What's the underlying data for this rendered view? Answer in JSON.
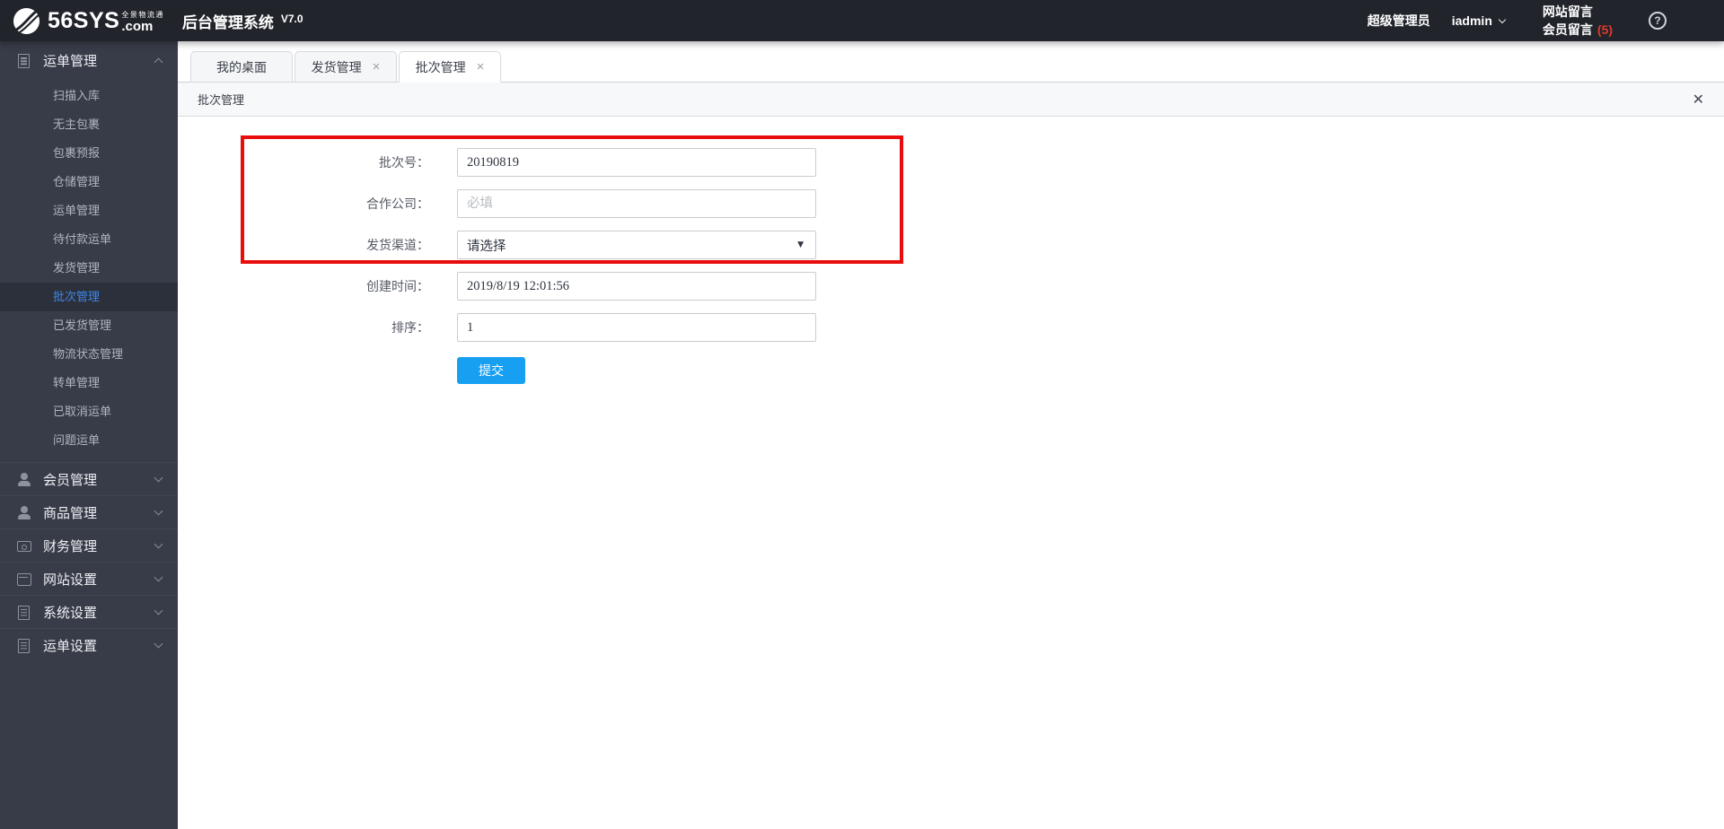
{
  "header": {
    "brand": "56SYS",
    "brand_tld": ".com",
    "brand_tagline": "全景物流通",
    "app_title": "后台管理系统",
    "version": "V7.0",
    "role": "超级管理员",
    "username": "iadmin",
    "nav": [
      {
        "label": "网站留言"
      },
      {
        "label": "会员留言",
        "badge": "(5)"
      }
    ]
  },
  "icons": {
    "close": "×",
    "panel_close": "✕",
    "dropdown": "▼",
    "help": "?"
  },
  "sidebar": {
    "primary": {
      "label": "运单管理",
      "icon": "document-icon"
    },
    "sub_items": [
      {
        "label": "扫描入库"
      },
      {
        "label": "无主包裹"
      },
      {
        "label": "包裹预报"
      },
      {
        "label": "仓储管理"
      },
      {
        "label": "运单管理"
      },
      {
        "label": "待付款运单"
      },
      {
        "label": "发货管理"
      },
      {
        "label": "批次管理",
        "active": true
      },
      {
        "label": "已发货管理"
      },
      {
        "label": "物流状态管理"
      },
      {
        "label": "转单管理"
      },
      {
        "label": "已取消运单"
      },
      {
        "label": "问题运单"
      }
    ],
    "groups": [
      {
        "label": "会员管理",
        "icon": "user-icon"
      },
      {
        "label": "商品管理",
        "icon": "user-icon"
      },
      {
        "label": "财务管理",
        "icon": "finance-icon"
      },
      {
        "label": "网站设置",
        "icon": "window-icon"
      },
      {
        "label": "系统设置",
        "icon": "document-icon"
      },
      {
        "label": "运单设置",
        "icon": "document-icon"
      }
    ]
  },
  "tabs": [
    {
      "label": "我的桌面",
      "closable": false
    },
    {
      "label": "发货管理",
      "closable": true
    },
    {
      "label": "批次管理",
      "closable": true,
      "active": true
    }
  ],
  "panel": {
    "title": "批次管理"
  },
  "form": {
    "fields": [
      {
        "label": "批次号：",
        "is_input": true,
        "value": "20190819"
      },
      {
        "label": "合作公司：",
        "is_input": true,
        "value": "",
        "placeholder": "必填"
      },
      {
        "label": "发货渠道：",
        "is_select": true,
        "value": "请选择"
      },
      {
        "label": "创建时间：",
        "is_input": true,
        "value": "2019/8/19 12:01:56"
      },
      {
        "label": "排序：",
        "is_input": true,
        "value": "1"
      }
    ],
    "submit_label": "提交"
  },
  "colors": {
    "accent": "#17a0f2",
    "annotation": "#e80c0c",
    "badge": "#e03a2f",
    "active_menu": "#3d87e8"
  }
}
